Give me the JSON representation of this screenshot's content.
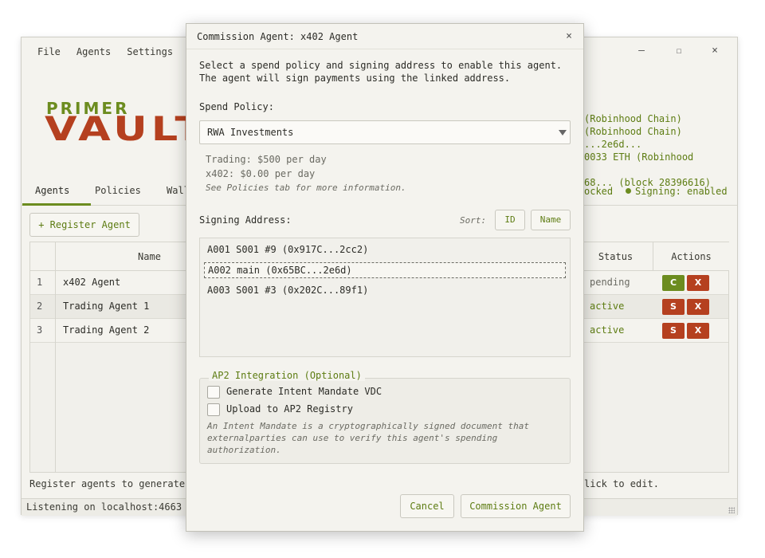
{
  "main_window": {
    "menu": [
      "File",
      "Agents",
      "Settings"
    ],
    "window_controls": {
      "minimize": "–",
      "maximize": "☐",
      "close": "×"
    },
    "logo": {
      "top": "PRIMER",
      "bottom": "VAULT"
    },
    "chain_info_lines": [
      "(Robinhood Chain)",
      "(Robinhood Chain)",
      "...2e6d...",
      "0033 ETH (Robinhood",
      "",
      "68... (block 28396616)"
    ],
    "tabs": [
      "Agents",
      "Policies",
      "Wall"
    ],
    "status": {
      "locked": "ocked",
      "signing": "Signing: enabled"
    },
    "register_button": "+ Register Agent",
    "table": {
      "headers": {
        "name": "Name",
        "status": "Status",
        "actions": "Actions"
      },
      "rows": [
        {
          "num": "1",
          "name": "x402 Agent",
          "status": "pending",
          "status_kind": "pending",
          "actions": [
            "C",
            "X"
          ]
        },
        {
          "num": "2",
          "name": "Trading Agent 1",
          "status": "active",
          "status_kind": "active",
          "actions": [
            "S",
            "X"
          ]
        },
        {
          "num": "3",
          "name": "Trading Agent 2",
          "status": "active",
          "status_kind": "active",
          "actions": [
            "S",
            "X"
          ]
        }
      ]
    },
    "footer_hint_left": "Register agents to generate",
    "footer_hint_right": "lick to edit.",
    "statusbar": "Listening on localhost:4663"
  },
  "dialog": {
    "title": "Commission Agent: x402 Agent",
    "close": "×",
    "intro": "Select a spend policy and signing address to enable this agent.\nThe agent will sign payments using the linked address.",
    "spend_policy_label": "Spend Policy:",
    "spend_policy_value": "RWA Investments",
    "policy_details": [
      "Trading: $500 per day",
      "x402: $0.00 per day"
    ],
    "policy_note": "See Policies tab for more information.",
    "signing_label": "Signing Address:",
    "sort_label": "Sort:",
    "sort_buttons": [
      "ID",
      "Name"
    ],
    "addresses": [
      {
        "text": "A001  S001 #9  (0x917C...2cc2)",
        "selected": false
      },
      {
        "text": "A002  main  (0x65BC...2e6d)",
        "selected": true
      },
      {
        "text": "A003  S001 #3  (0x202C...89f1)",
        "selected": false
      }
    ],
    "ap2_legend": "AP2 Integration (Optional)",
    "ap2_options": [
      "Generate Intent Mandate VDC",
      "Upload to AP2 Registry"
    ],
    "ap2_note": "An Intent Mandate is a cryptographically signed document that externalparties can use to verify this agent's spending authorization.",
    "cancel_button": "Cancel",
    "commission_button": "Commission Agent"
  },
  "colors": {
    "accent_green": "#6c8c1f",
    "accent_red": "#b5401f",
    "background": "#f4f3ee"
  }
}
